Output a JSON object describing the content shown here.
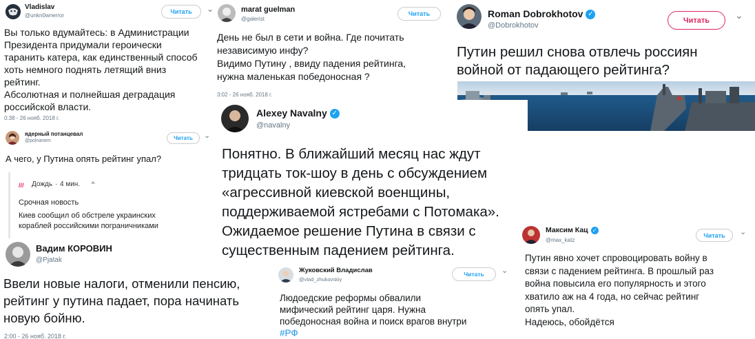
{
  "follow_label": "Читать",
  "follow_label_caps": "Читать",
  "verified_glyph": "✓",
  "chevron_glyph": "⌄",
  "colors": {
    "accent": "#1da1f2",
    "muted": "#657786",
    "text": "#14171a",
    "red_button": "#e0245e"
  },
  "tweets": {
    "vladislav": {
      "name": "Vladislav",
      "handle": "@unkn0wnerror",
      "text": "Вы только вдумайтесь: в Администрации\nПрезидента придумали героически\nтаранить катера, как единственный способ\nхоть немного поднять летящий вниз\nрейтинг.\nАбсолютная и полнейшая деградация\nроссийской власти.",
      "time": "0:38 - 26 нояб. 2018 г."
    },
    "guelman": {
      "name": "marat guelman",
      "handle": "@galerist",
      "text": "День не был в сети и война. Где почитать\nнезависимую инфу?\nВидимо Путину , ввиду падения рейтинга,\nнужна маленькая победоносная ?",
      "time": "3:02 - 26 нояб. 2018 г."
    },
    "dobrokhotov": {
      "name": "Roman Dobrokhotov",
      "handle": "@Dobrokhotov",
      "text": "Путин решил снова отвлечь россиян\nвойной от падающего рейтинга?"
    },
    "potanceval": {
      "name": "ядерный потанцевал",
      "handle": "@polnanem",
      "text": "А чего, у Путина опять рейтинг упал?",
      "embed": {
        "source": "Дождь",
        "age": "4 мин.",
        "caret": "^",
        "title": "Срочная новость",
        "body": "Киев сообщил об обстреле украинских\nкораблей российскими пограничниками"
      }
    },
    "navalny": {
      "name": "Alexey Navalny",
      "handle": "@navalny",
      "text": "Понятно. В ближайший месяц нас ждут\nтридцать ток-шоу в день с обсуждением\n«агрессивной киевской военщины,\nподдерживаемой ястребами с Потомака».\nОжидаемое решение Путина в связи с\nсущественным падением рейтинга."
    },
    "korovin": {
      "name": "Вадим КОРОВИН",
      "handle": "@Pjatak",
      "text": "Ввели новые налоги, отменили пенсию,\nрейтинг у путина падает, пора начинать\nновую бойню.",
      "time": "2:00 - 26 нояб. 2018 г."
    },
    "zhukovsky": {
      "name": "Жуковский Владислав",
      "handle": "@vlad_zhukovskiy",
      "text": "Людоедские реформы обвалили\nмифический рейтинг царя. Нужна\nпобедоносная война и поиск врагов внутри",
      "hashtag": "#РФ"
    },
    "katz": {
      "name": "Максим Кац",
      "handle": "@max_katz",
      "text": "Путин явно хочет спровоцировать войну в\nсвязи с падением рейтинга. В прошлый раз\nвойна повысила его популярность и этого\nхватило аж на 4 года, но сейчас рейтинг\nопять упал.\nНадеюсь, обойдётся"
    }
  }
}
